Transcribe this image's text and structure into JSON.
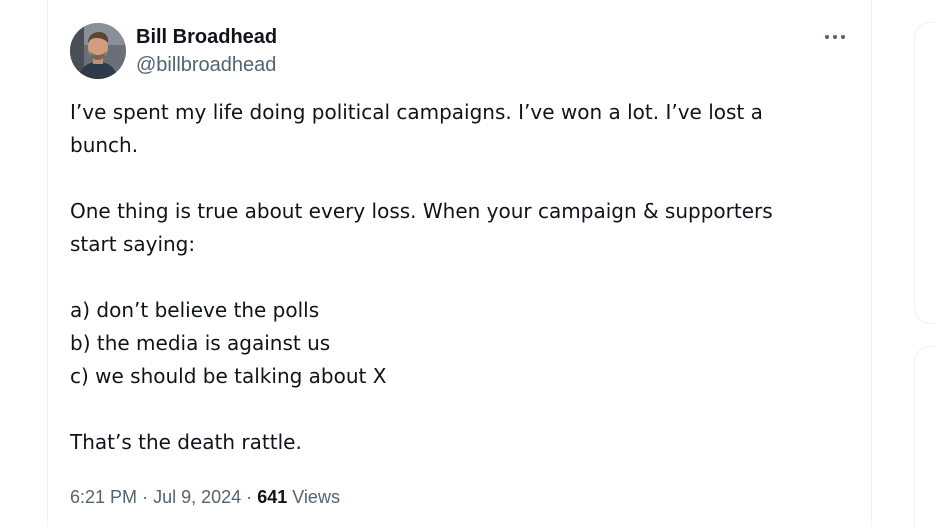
{
  "tweet": {
    "author": {
      "display_name": "Bill Broadhead",
      "handle": "@billbroadhead"
    },
    "body_lines": [
      "I’ve spent my life doing political campaigns. I’ve won a lot. I’ve lost a",
      "bunch.",
      "",
      "One thing is true about every loss. When your campaign & supporters",
      "start saying:",
      "",
      "a) don’t believe the polls",
      "b) the media is against us",
      "c) we should be talking about X",
      "",
      "That’s the death rattle."
    ],
    "time": "6:21 PM",
    "separator": "·",
    "date": "Jul 9, 2024",
    "views_count": "641",
    "views_label": "Views",
    "more_icon": "ellipsis-icon"
  },
  "colors": {
    "primary_text": "#0f1419",
    "secondary_text": "#536471",
    "border": "#eff3f4"
  }
}
